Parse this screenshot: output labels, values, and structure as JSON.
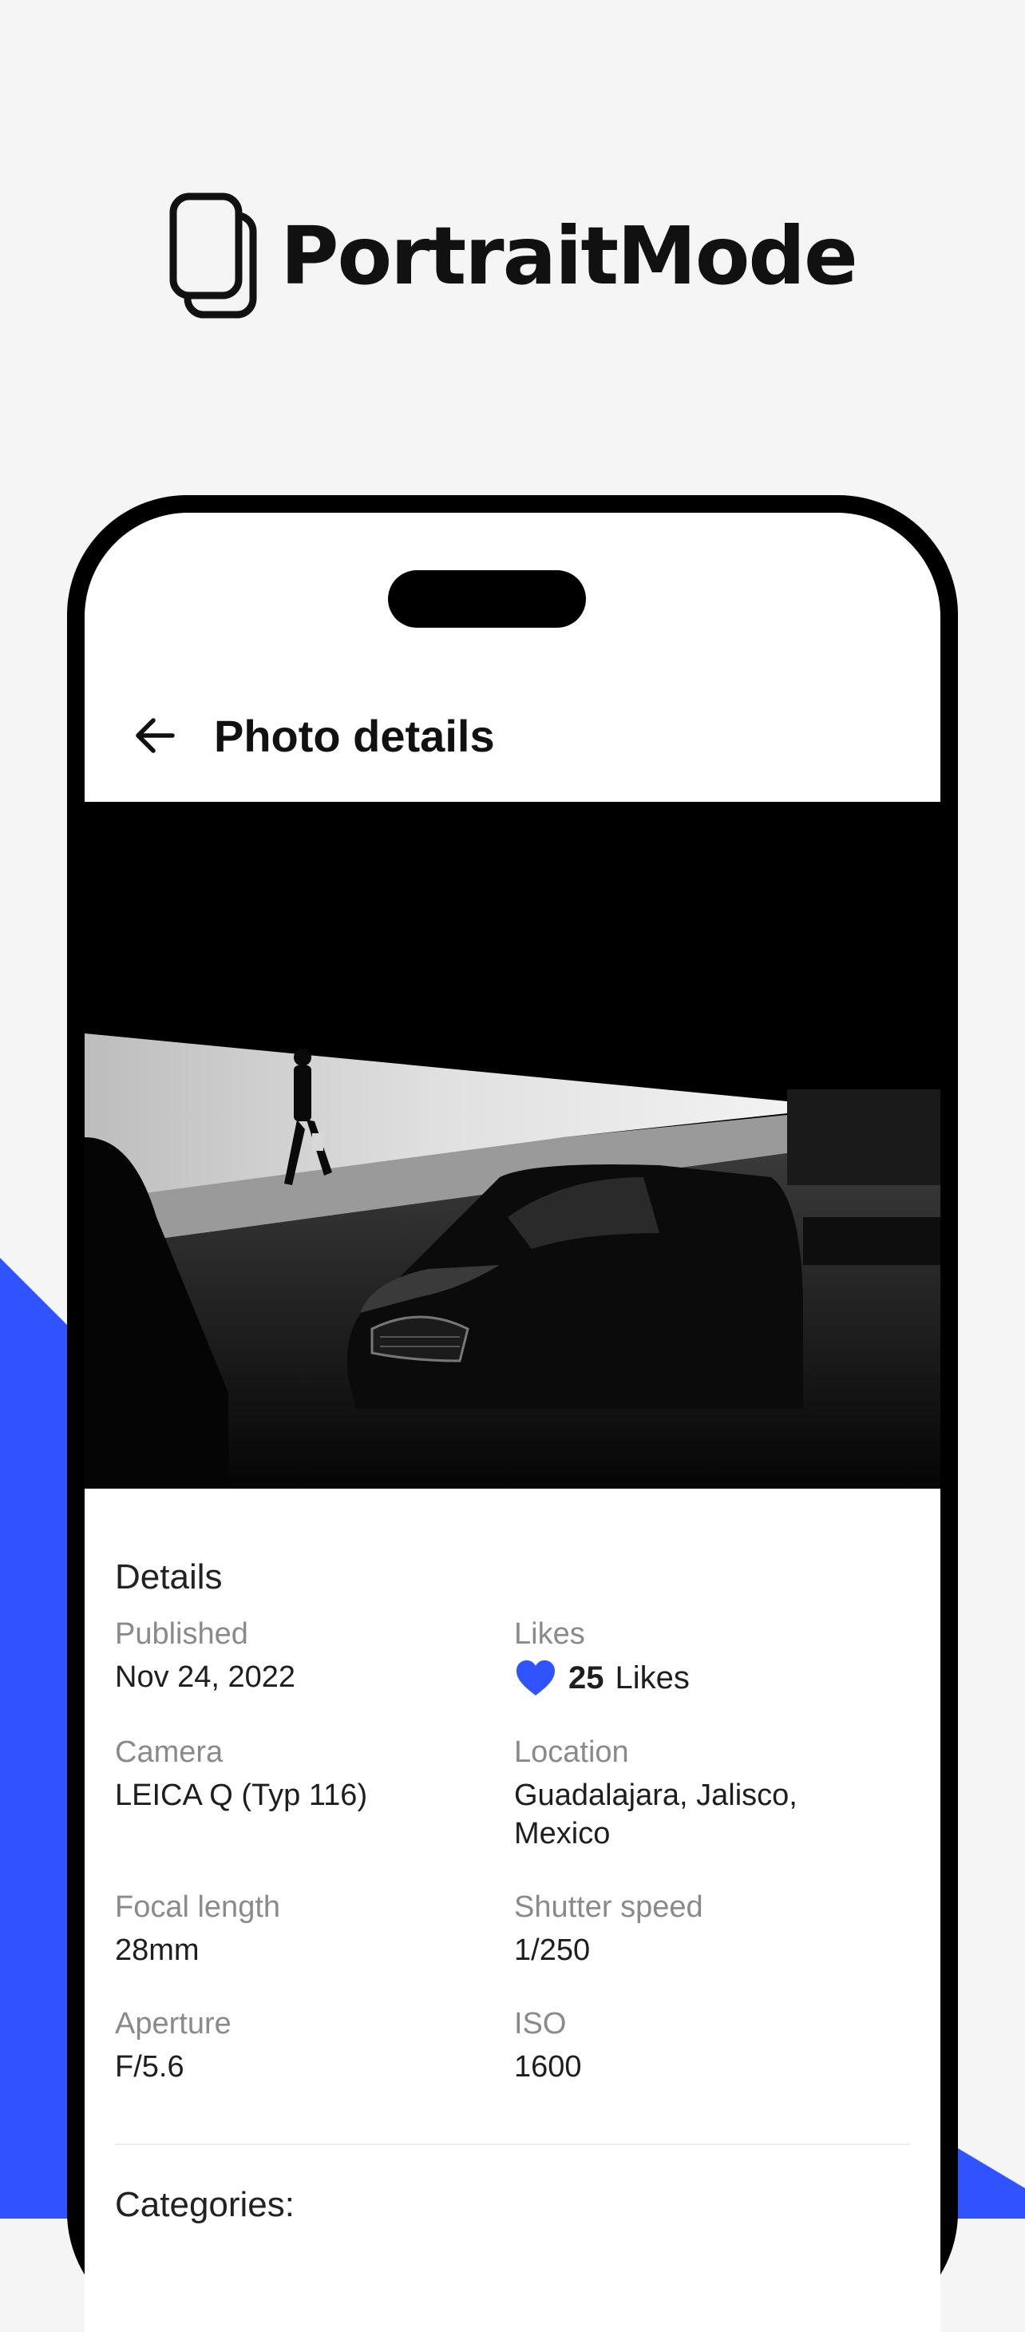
{
  "brand": {
    "name": "PortraitMode",
    "icon": "stacked-phones-icon"
  },
  "colors": {
    "accent": "#2f54ff",
    "background": "#f5f5f5",
    "phone_frame": "#000000"
  },
  "header": {
    "back_icon": "arrow-left-icon",
    "title": "Photo details"
  },
  "photo": {
    "description_icon": "photo-image"
  },
  "details": {
    "section_title": "Details",
    "published": {
      "label": "Published",
      "value": "Nov 24, 2022"
    },
    "likes": {
      "label": "Likes",
      "icon": "heart-icon",
      "count": "25",
      "word": "Likes"
    },
    "camera": {
      "label": "Camera",
      "value": "LEICA Q (Typ 116)"
    },
    "location": {
      "label": "Location",
      "value": "Guadalajara, Jalisco, Mexico"
    },
    "focal_length": {
      "label": "Focal length",
      "value": "28mm"
    },
    "shutter_speed": {
      "label": "Shutter speed",
      "value": "1/250"
    },
    "aperture": {
      "label": "Aperture",
      "value": "F/5.6"
    },
    "iso": {
      "label": "ISO",
      "value": "1600"
    }
  },
  "categories": {
    "title": "Categories:"
  }
}
